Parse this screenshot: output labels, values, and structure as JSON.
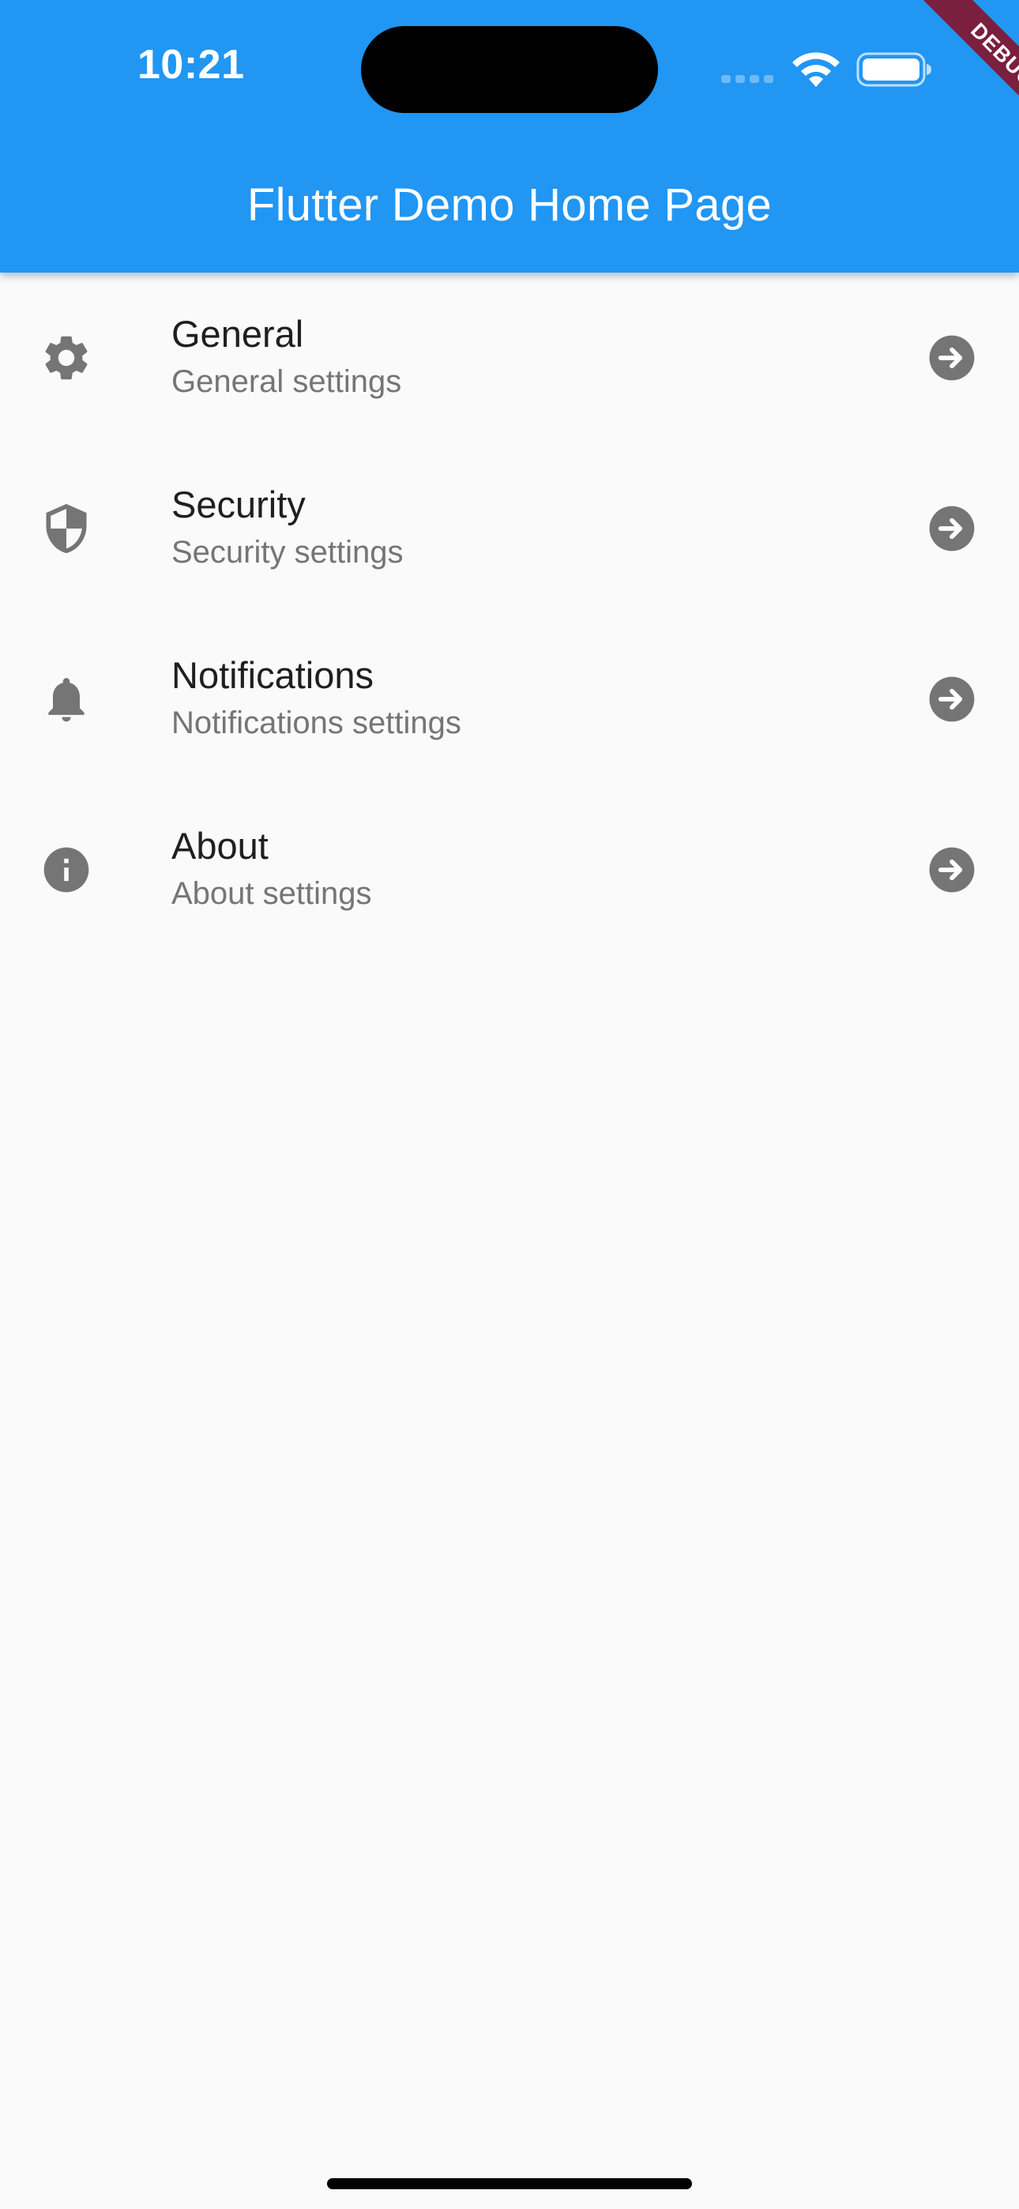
{
  "status_bar": {
    "time": "10:21"
  },
  "app_bar": {
    "title": "Flutter Demo Home Page",
    "color": "#2196f3"
  },
  "debug_banner": {
    "label": "DEBUG",
    "color": "#7a1f3d"
  },
  "settings": {
    "items": [
      {
        "title": "General",
        "subtitle": "General settings",
        "icon": "gear-icon"
      },
      {
        "title": "Security",
        "subtitle": "Security settings",
        "icon": "shield-icon"
      },
      {
        "title": "Notifications",
        "subtitle": "Notifications settings",
        "icon": "bell-icon"
      },
      {
        "title": "About",
        "subtitle": "About settings",
        "icon": "info-icon"
      }
    ],
    "trailing_icon": "arrow-circle-right-icon",
    "icon_color": "#757575"
  }
}
